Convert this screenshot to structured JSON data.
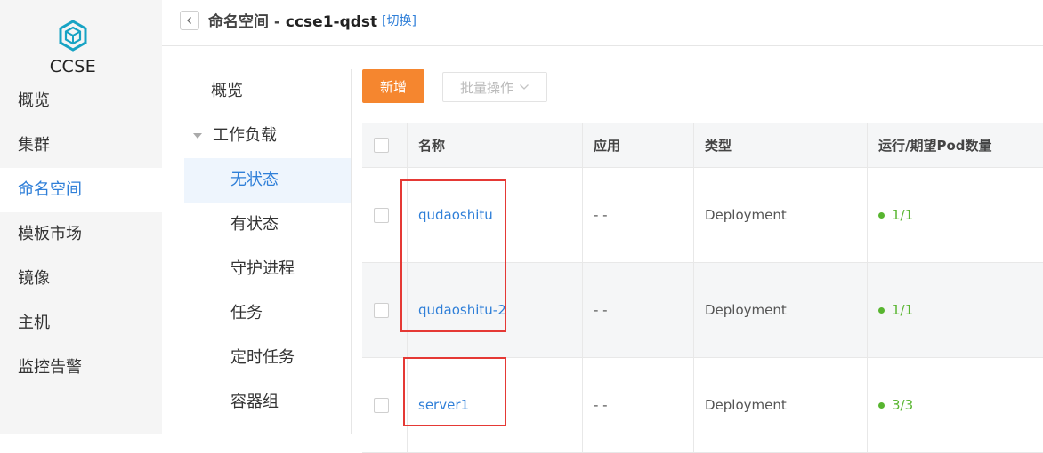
{
  "app": {
    "logo_text": "CCSE"
  },
  "global_nav": [
    {
      "label": "概览"
    },
    {
      "label": "集群"
    },
    {
      "label": "命名空间"
    },
    {
      "label": "模板市场"
    },
    {
      "label": "镜像"
    },
    {
      "label": "主机"
    },
    {
      "label": "监控告警"
    }
  ],
  "header": {
    "title_prefix": "命名空间 - ",
    "title_name": "ccse1-qdst",
    "switch_label": "[切换]"
  },
  "sub_nav": [
    {
      "label": "概览"
    },
    {
      "label": "工作负载"
    },
    {
      "label": "无状态"
    },
    {
      "label": "有状态"
    },
    {
      "label": "守护进程"
    },
    {
      "label": "任务"
    },
    {
      "label": "定时任务"
    },
    {
      "label": "容器组"
    }
  ],
  "toolbar": {
    "add_label": "新增",
    "batch_label": "批量操作"
  },
  "table": {
    "columns": [
      "名称",
      "应用",
      "类型",
      "运行/期望Pod数量"
    ],
    "rows": [
      {
        "name": "qudaoshitu",
        "app": "- -",
        "type": "Deployment",
        "pods": "1/1"
      },
      {
        "name": "qudaoshitu-2",
        "app": "- -",
        "type": "Deployment",
        "pods": "1/1"
      },
      {
        "name": "server1",
        "app": "- -",
        "type": "Deployment",
        "pods": "3/3"
      }
    ]
  },
  "colors": {
    "accent": "#2f7fd8",
    "add_button": "#f5862f",
    "status_ok": "#58b530",
    "annotation": "#e53935"
  }
}
